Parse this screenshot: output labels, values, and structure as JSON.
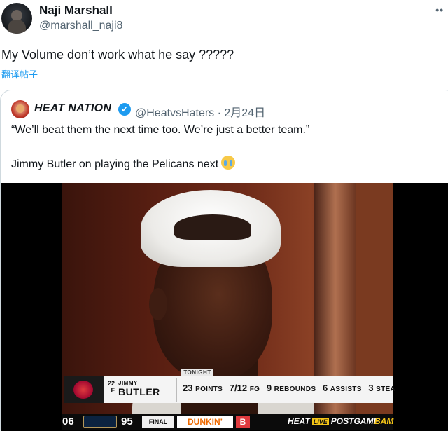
{
  "tweet": {
    "author_name": "Naji Marshall",
    "author_handle": "@marshall_naji8",
    "more_icon": "more-horizontal-icon",
    "text": "My Volume don’t work what he say ?????",
    "translate_label": "翻译帖子"
  },
  "quote": {
    "author_name": "HEAT NATION",
    "verified_icon": "verified-badge-icon",
    "handle_date": "@HeatvsHaters · 2月24日",
    "text_line1": "“We’ll beat them the next time too. We’re just a better team.”",
    "text_line2": "Jimmy Butler on playing the Pelicans next",
    "emoji": "loudly-crying-face-icon"
  },
  "media": {
    "lower_third": {
      "tag": "TONIGHT",
      "number": "22",
      "position": "F",
      "first_name": "JIMMY",
      "last_name": "BUTLER",
      "stats": [
        {
          "value": "23",
          "label": "POINTS"
        },
        {
          "value": "7/12",
          "label": "FG"
        },
        {
          "value": "9",
          "label": "REBOUNDS"
        },
        {
          "value": "6",
          "label": "ASSISTS"
        },
        {
          "value": "3",
          "label": "STEA"
        }
      ]
    },
    "ticker": {
      "score_home": "06",
      "score_away": "95",
      "status": "FINAL",
      "sponsor": "DUNKIN’",
      "sponsor_mark": "B",
      "show_prefix": "HEAT",
      "show_live": "LIVE",
      "show_suffix": "POSTGAME",
      "show_tail": "BAM"
    }
  },
  "colors": {
    "link": "#1d9bf0",
    "text": "#0f1419",
    "muted": "#536471",
    "border": "#cfd9de"
  }
}
